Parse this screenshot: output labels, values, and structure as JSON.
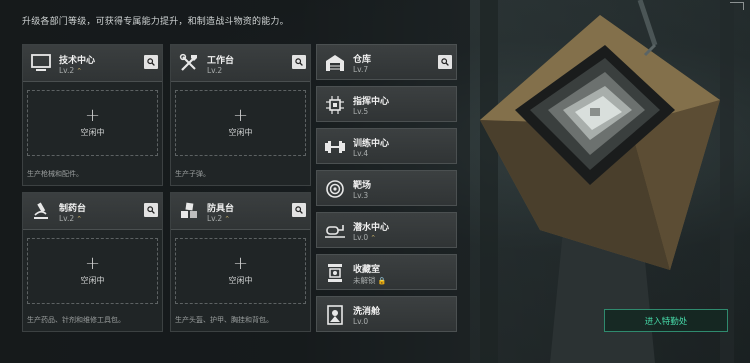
{
  "header": {
    "subtitle": "升级各部门等级，可获得专属能力提升，和制造战斗物资的能力。"
  },
  "workshops": [
    {
      "name": "技术中心",
      "level": "Lv.2",
      "icon": "monitor-icon",
      "slot_label": "空闲中",
      "description": "生产枪械和配件。"
    },
    {
      "name": "工作台",
      "level": "Lv.2",
      "icon": "tools-icon",
      "slot_label": "空闲中",
      "description": "生产子弹。"
    },
    {
      "name": "制药台",
      "level": "Lv.2",
      "icon": "microscope-icon",
      "slot_label": "空闲中",
      "description": "生产药品、针剂和维修工具包。"
    },
    {
      "name": "防具台",
      "level": "Lv.2",
      "icon": "cubes-icon",
      "slot_label": "空闲中",
      "description": "生产头盔、护甲、胸挂和背包。"
    }
  ],
  "facilities": [
    {
      "name": "仓库",
      "level": "Lv.7",
      "icon": "warehouse-icon"
    },
    {
      "name": "指挥中心",
      "level": "Lv.5",
      "icon": "chip-icon"
    },
    {
      "name": "训练中心",
      "level": "Lv.4",
      "icon": "dumbbell-icon"
    },
    {
      "name": "靶场",
      "level": "Lv.3",
      "icon": "target-icon"
    },
    {
      "name": "潜水中心",
      "level": "Lv.0",
      "icon": "diving-icon"
    },
    {
      "name": "收藏室",
      "level": "未解锁",
      "icon": "collection-icon"
    },
    {
      "name": "洗消舱",
      "level": "Lv.0",
      "icon": "decontamination-icon"
    }
  ],
  "enter_button": "进入特勤处",
  "colors": {
    "accent": "#46d9a8",
    "level_mark": "#c9b36a",
    "panel": "#303435"
  }
}
